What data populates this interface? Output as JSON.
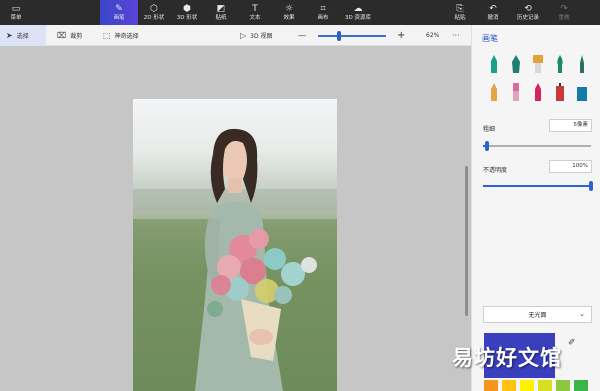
{
  "topbar": {
    "menu": {
      "label": "菜单",
      "icon": "folder-icon"
    },
    "tabs": [
      {
        "label": "画笔",
        "icon": "brush-icon",
        "glyph": "✎",
        "active": true
      },
      {
        "label": "2D 形状",
        "icon": "shapes-2d-icon",
        "glyph": "⬡"
      },
      {
        "label": "3D 形状",
        "icon": "cube-icon",
        "glyph": "⬢"
      },
      {
        "label": "贴纸",
        "icon": "sticker-icon",
        "glyph": "◩"
      },
      {
        "label": "文本",
        "icon": "text-icon",
        "glyph": "T"
      },
      {
        "label": "效果",
        "icon": "effects-icon",
        "glyph": "☼"
      },
      {
        "label": "画布",
        "icon": "canvas-icon",
        "glyph": "⌗"
      },
      {
        "label": "3D 资源库",
        "icon": "library-3d-icon",
        "glyph": "☁"
      }
    ],
    "actions": [
      {
        "label": "粘贴",
        "icon": "paste-icon",
        "glyph": "⎘"
      },
      {
        "label": "撤消",
        "icon": "undo-icon",
        "glyph": "↶"
      },
      {
        "label": "历史记录",
        "icon": "history-icon",
        "glyph": "⟲"
      },
      {
        "label": "重做",
        "icon": "redo-icon",
        "glyph": "↷",
        "disabled": true
      }
    ]
  },
  "subbar": {
    "select": {
      "label": "选择",
      "icon": "cursor-icon"
    },
    "crop": {
      "label": "裁剪",
      "icon": "crop-icon"
    },
    "magic_select": {
      "label": "神奇选择",
      "icon": "magic-select-icon"
    },
    "view3d": {
      "label": "3D 视图",
      "icon": "view-3d-icon"
    },
    "zoom_out": "—",
    "zoom_in": "+",
    "zoom_level": "62%",
    "zoom_fraction": 0.28,
    "more": "···"
  },
  "panel": {
    "title": "画笔",
    "brushes_row1": [
      {
        "icon": "marker-icon",
        "color": "#17a28a"
      },
      {
        "icon": "calligraphy-pen-icon",
        "color": "#1c7f6f"
      },
      {
        "icon": "oil-brush-icon",
        "color": "#e1a23b"
      },
      {
        "icon": "watercolor-brush-icon",
        "color": "#1f8a5f"
      },
      {
        "icon": "pixel-pen-icon",
        "color": "#2b6e65"
      }
    ],
    "brushes_row2": [
      {
        "icon": "pencil-icon",
        "color": "#e3a646"
      },
      {
        "icon": "eraser-icon",
        "color": "#d86aa0"
      },
      {
        "icon": "crayon-icon",
        "color": "#d2245d"
      },
      {
        "icon": "spraycan-icon",
        "color": "#c83a3a"
      },
      {
        "icon": "fill-bucket-icon",
        "color": "#157ca9"
      }
    ],
    "thickness": {
      "label": "粗细",
      "value": "5像素",
      "fraction": 0.04
    },
    "opacity": {
      "label": "不透明度",
      "value": "100%",
      "fraction": 1.0
    },
    "finish": {
      "label": "无光面"
    },
    "current_color": "#3a3fbe",
    "palette": [
      "#f7941d",
      "#ffc20e",
      "#fff200",
      "#d7df23",
      "#8dc63f",
      "#39b54a"
    ]
  },
  "watermark": "易坊好文馆"
}
